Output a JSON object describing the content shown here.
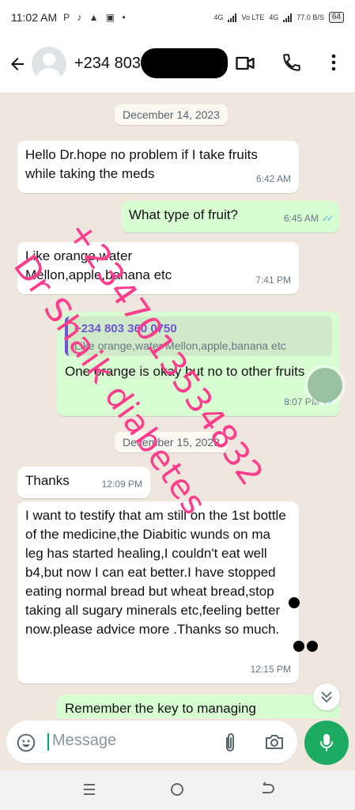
{
  "status_bar": {
    "time": "11:02 AM",
    "app_icons": "P ♪ ▲ ▣ •",
    "net1": "4G",
    "net2": "Vo LTE",
    "net3": "4G",
    "speed": "77.0 B/S",
    "battery": "64"
  },
  "header": {
    "contact_number": "+234 803",
    "icons": [
      "back-arrow-icon",
      "avatar",
      "video-call-icon",
      "phone-icon",
      "more-vert-icon"
    ]
  },
  "chat": {
    "date1": "December 14, 2023",
    "date2": "December 15, 2023",
    "msg1": {
      "text": "Hello Dr.hope no problem if I take fruits while taking  the meds",
      "time": "6:42 AM"
    },
    "msg2": {
      "text": "What type of fruit?",
      "time": "6:45 AM"
    },
    "msg3": {
      "text": "Like orange,water Mellon,apple,banana etc",
      "time": "7:41 PM"
    },
    "msg4": {
      "quote_name": "+234 803 360 0750",
      "quote_text": "Like orange,water Mellon,apple,banana etc",
      "text": "One orange is okay but no to other fruits",
      "time": "8:07 PM"
    },
    "msg5": {
      "text": "Thanks",
      "time": "12:09 PM"
    },
    "msg6": {
      "text": "I want to testify that am still on the 1st bottle  of the medicine,the Diabitic wunds on ma leg has started healing,I couldn't eat well b4,but now I can eat better.I have stopped eating normal bread but wheat bread,stop taking all sugary minerals etc,feeling better now.please advice more .Thanks so much.",
      "time": "12:15 PM"
    },
    "msg7": {
      "text": "Remember the key to managing"
    }
  },
  "watermark": {
    "line1": "+2347013534832",
    "line2": "Dr Shaik diabetes",
    "color": "#ff3d8d"
  },
  "composer": {
    "placeholder": "Message"
  },
  "colors": {
    "accent_green": "#1daa61",
    "outgoing_bubble": "#d9fdd3",
    "read_ticks": "#53bdeb",
    "chat_bg": "#efe7dd"
  }
}
